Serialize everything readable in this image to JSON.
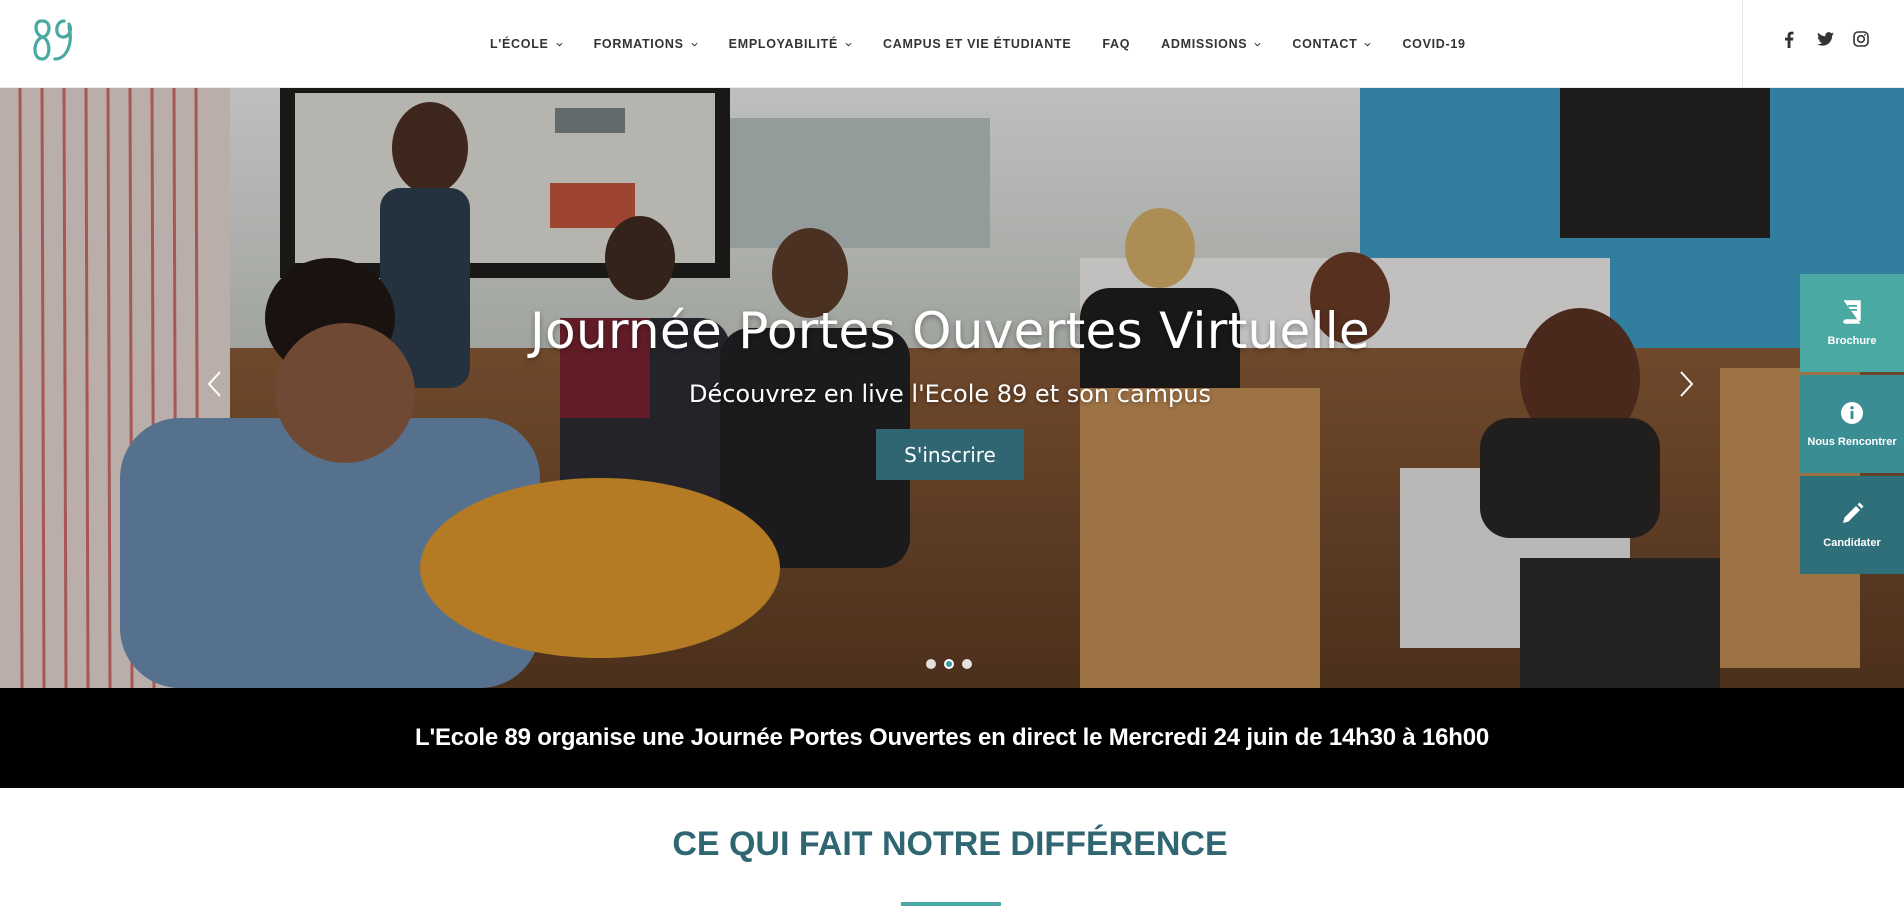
{
  "brand": {
    "logo_text": "89",
    "accent": "#4aa9a2",
    "dark_accent": "#2f6672"
  },
  "nav": {
    "items": [
      {
        "label": "L'ÉCOLE",
        "has_dropdown": true
      },
      {
        "label": "FORMATIONS",
        "has_dropdown": true
      },
      {
        "label": "EMPLOYABILITÉ",
        "has_dropdown": true
      },
      {
        "label": "CAMPUS ET VIE ÉTUDIANTE",
        "has_dropdown": false
      },
      {
        "label": "FAQ",
        "has_dropdown": false
      },
      {
        "label": "ADMISSIONS",
        "has_dropdown": true
      },
      {
        "label": "CONTACT",
        "has_dropdown": true
      },
      {
        "label": "COVID-19",
        "has_dropdown": false
      }
    ]
  },
  "social": {
    "icons": [
      "facebook-icon",
      "twitter-icon",
      "instagram-icon"
    ]
  },
  "hero": {
    "title": "Journée Portes Ouvertes Virtuelle",
    "subtitle": "Découvrez en live l'Ecole 89 et son campus",
    "button_label": "S'inscrire",
    "slides_count": 3,
    "active_slide": 2
  },
  "side_cta": {
    "brochure": "Brochure",
    "meet": "Nous Rencontrer",
    "apply": "Candidater"
  },
  "banner": {
    "text": "L'Ecole 89 organise une Journée Portes Ouvertes en direct le Mercredi 24 juin de 14h30 à 16h00"
  },
  "section": {
    "title": "CE QUI FAIT NOTRE DIFFÉRENCE"
  }
}
